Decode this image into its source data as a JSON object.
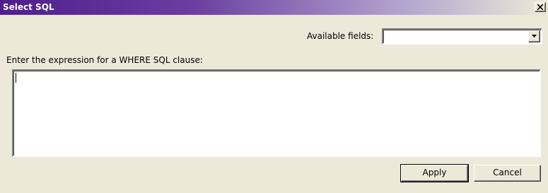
{
  "window": {
    "title": "Select SQL"
  },
  "fields": {
    "label": "Available fields:",
    "selected": ""
  },
  "expression": {
    "label": "Enter the expression for a WHERE SQL clause:",
    "value": ""
  },
  "buttons": {
    "apply": "Apply",
    "cancel": "Cancel"
  },
  "icons": {
    "close": "close-icon",
    "dropdown": "chevron-down-icon"
  }
}
